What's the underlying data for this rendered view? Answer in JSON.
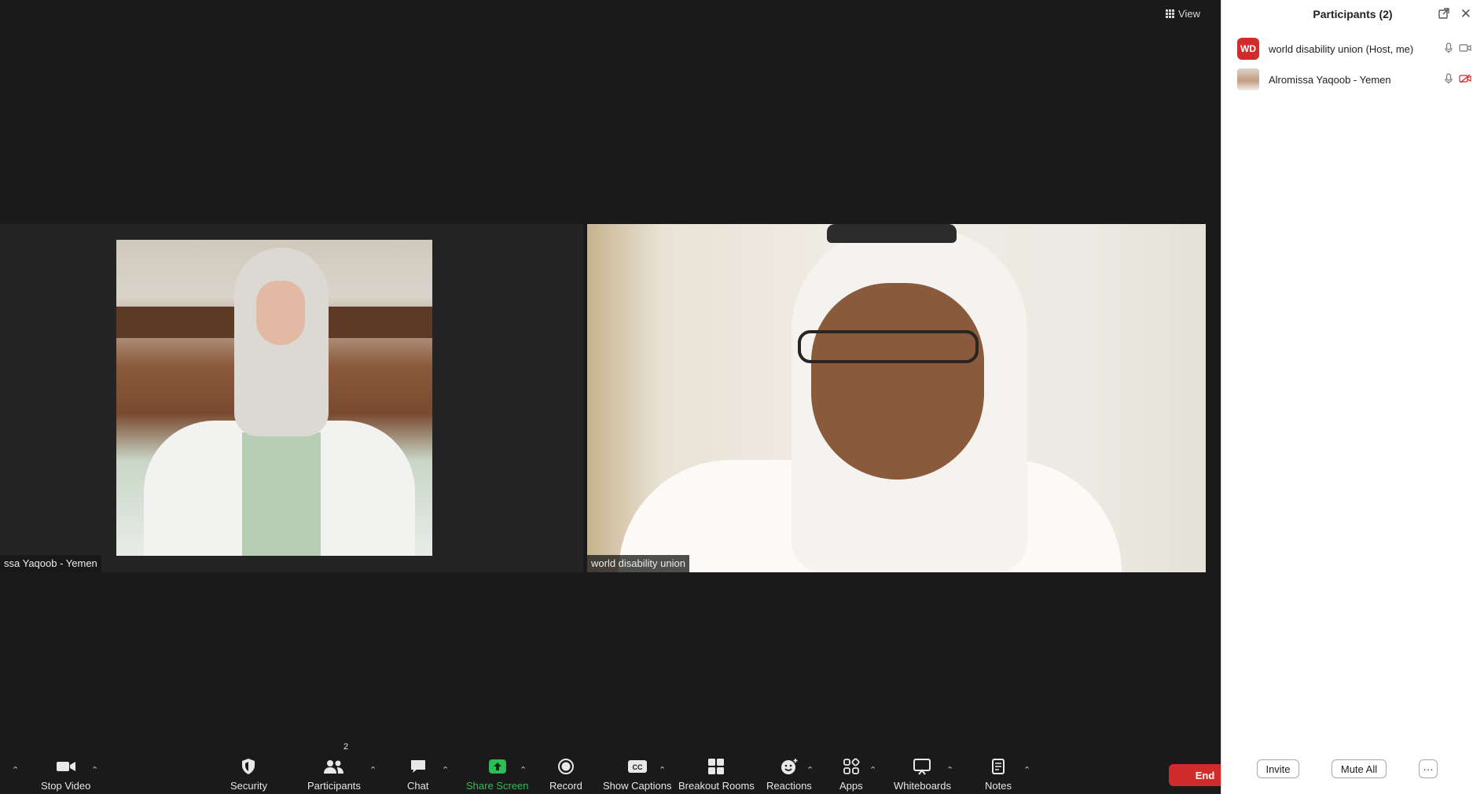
{
  "meeting": {
    "view_label": "View",
    "tiles": [
      {
        "name": "ssa Yaqoob  - Yemen"
      },
      {
        "name": "world disability union"
      }
    ]
  },
  "toolbar": {
    "items": [
      {
        "label": "Stop Video",
        "icon": "video-camera-icon"
      },
      {
        "label": "Security",
        "icon": "shield-icon"
      },
      {
        "label": "Participants",
        "icon": "people-icon",
        "badge": "2"
      },
      {
        "label": "Chat",
        "icon": "chat-bubble-icon"
      },
      {
        "label": "Share Screen",
        "icon": "share-screen-icon"
      },
      {
        "label": "Record",
        "icon": "record-icon"
      },
      {
        "label": "Show Captions",
        "icon": "cc-icon"
      },
      {
        "label": "Breakout Rooms",
        "icon": "breakout-rooms-icon"
      },
      {
        "label": "Reactions",
        "icon": "smiley-icon"
      },
      {
        "label": "Apps",
        "icon": "apps-icon"
      },
      {
        "label": "Whiteboards",
        "icon": "whiteboard-icon"
      },
      {
        "label": "Notes",
        "icon": "notes-icon"
      }
    ],
    "end_label": "End"
  },
  "panel": {
    "title": "Participants (2)",
    "participants": [
      {
        "avatar_text": "WD",
        "name": "world disability union (Host, me)",
        "camera": "on"
      },
      {
        "avatar_text": "",
        "name": "Alromissa Yaqoob  - Yemen",
        "camera": "off"
      }
    ],
    "invite_label": "Invite",
    "mute_all_label": "Mute All",
    "more_label": "···"
  },
  "colors": {
    "end_red": "#d22b2b",
    "share_green": "#2dbd57",
    "meeting_bg": "#1a1a1a"
  }
}
